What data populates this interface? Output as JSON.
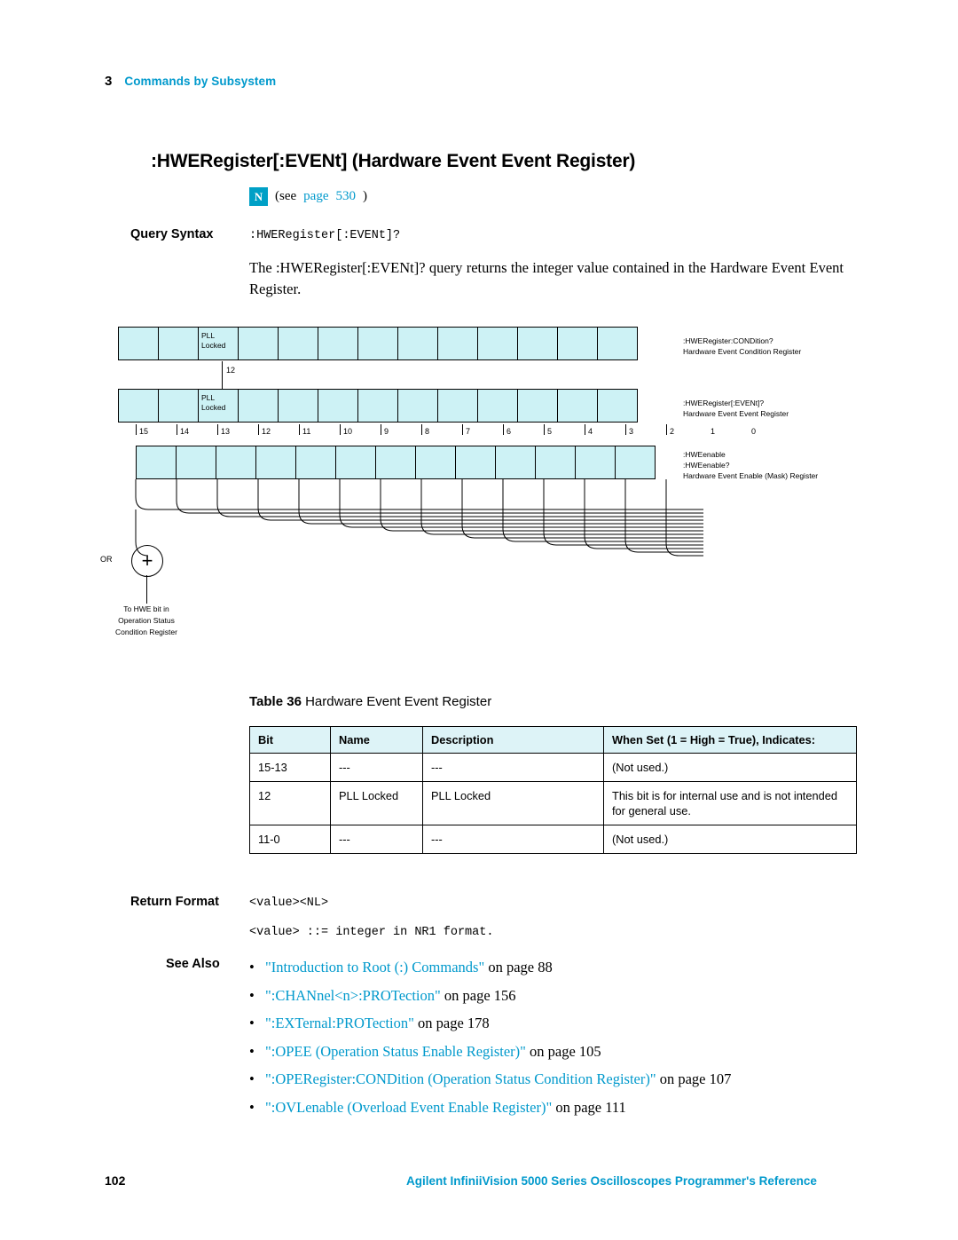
{
  "header": {
    "chapter_number": "3",
    "chapter_title": "Commands by Subsystem"
  },
  "title": ":HWERegister[:EVENt] (Hardware Event Event Register)",
  "note": {
    "badge": "N",
    "see_text": "(see",
    "page_link": "page",
    "page_number": "530",
    "close": ")"
  },
  "query": {
    "label": "Query Syntax",
    "code": ":HWERegister[:EVENt]?",
    "paragraph": "The :HWERegister[:EVENt]? query returns the integer value contained in the Hardware Event Event Register."
  },
  "diagram": {
    "condition_row": {
      "cell_label_line1": "PLL",
      "cell_label_line2": "Locked"
    },
    "event_row": {
      "cell_label_line1": "PLL",
      "cell_label_line2": "Locked"
    },
    "arrow_bit_number": "12",
    "bit_numbers": [
      "15",
      "14",
      "13",
      "12",
      "11",
      "10",
      "9",
      "8",
      "7",
      "6",
      "5",
      "4",
      "3",
      "2",
      "1",
      "0"
    ],
    "annotations": {
      "condition": {
        "line1": ":HWERegister:CONDition?",
        "line2": "Hardware Event Condition Register"
      },
      "event": {
        "line1": ":HWERegister[:EVENt]?",
        "line2": "Hardware Event Event Register"
      },
      "enable": {
        "line1": ":HWEenable",
        "line2": ":HWEenable?",
        "line3": "Hardware Event Enable (Mask) Register"
      }
    },
    "or_label": "OR",
    "or_symbol": "+",
    "to_hwe": {
      "line1": "To HWE bit in",
      "line2": "Operation Status",
      "line3": "Condition Register"
    }
  },
  "table": {
    "caption_label": "Table 36",
    "caption_text": "Hardware Event Event Register",
    "columns": [
      "Bit",
      "Name",
      "Description",
      "When Set (1 = High = True), Indicates:"
    ],
    "rows": [
      {
        "bit": "15-13",
        "name": "---",
        "description": "---",
        "indicates": "(Not used.)"
      },
      {
        "bit": "12",
        "name": "PLL Locked",
        "description": "PLL Locked",
        "indicates": "This bit is for internal use and is not intended for general use."
      },
      {
        "bit": "11-0",
        "name": "---",
        "description": "---",
        "indicates": "(Not used.)"
      }
    ]
  },
  "return_format": {
    "label": "Return Format",
    "line1": "<value><NL>",
    "line2": "<value> ::= integer in NR1 format."
  },
  "see_also": {
    "label": "See Also",
    "items": [
      {
        "quoted": "\"Introduction to Root (:) Commands\"",
        "tail": " on page 88"
      },
      {
        "quoted": "\":CHANnel<n>:PROTection\"",
        "tail": " on page 156"
      },
      {
        "quoted": "\":EXTernal:PROTection\"",
        "tail": " on page 178"
      },
      {
        "quoted": "\":OPEE (Operation Status Enable Register)\"",
        "tail": " on page 105"
      },
      {
        "quoted": "\":OPERegister:CONDition (Operation Status Condition Register)\"",
        "tail": " on page 107"
      },
      {
        "quoted": "\":OVLenable (Overload Event Enable Register)\"",
        "tail": " on page 111"
      }
    ]
  },
  "footer": {
    "page_number": "102",
    "text": "Agilent InfiniiVision 5000 Series Oscilloscopes Programmer's Reference"
  }
}
